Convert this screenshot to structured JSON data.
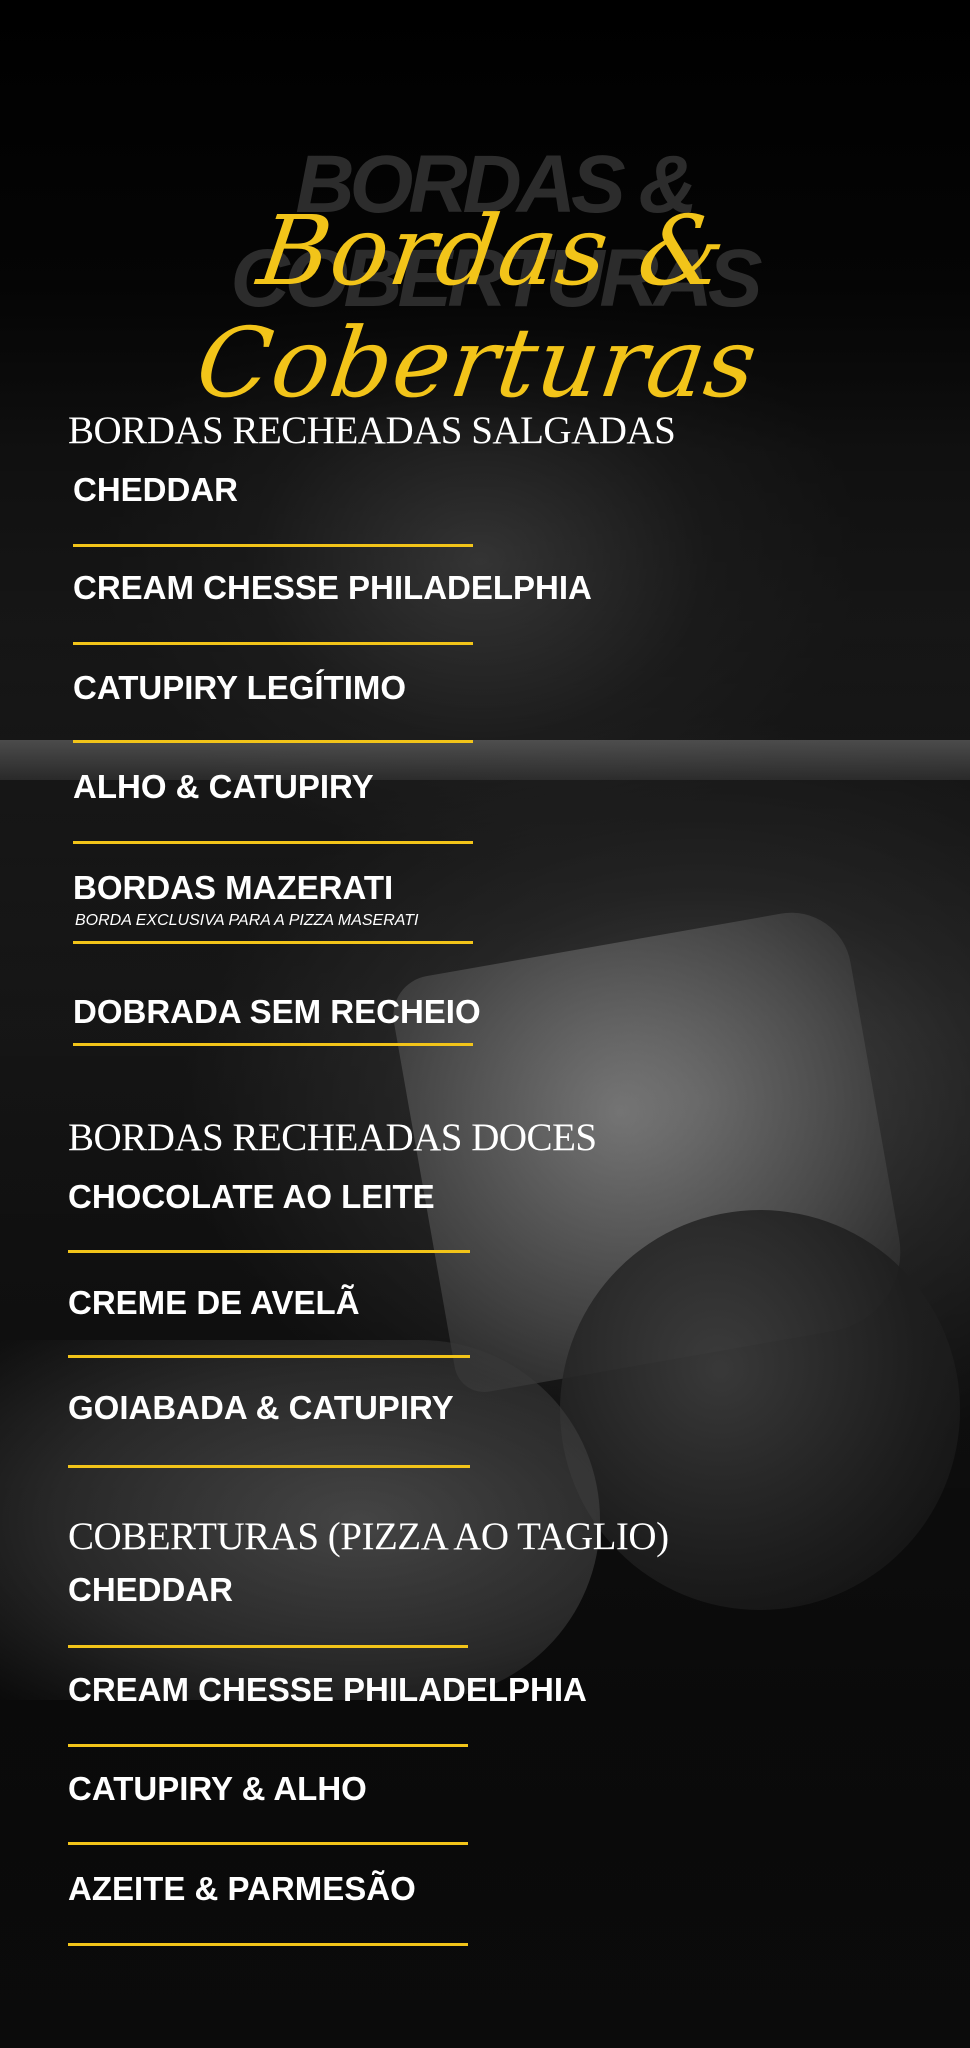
{
  "header": {
    "ghost_title": "BORDAS & COBERTURAS",
    "script_title": "Bordas & Coberturas"
  },
  "sections": [
    {
      "title": "BORDAS RECHEADAS SALGADAS",
      "items": [
        {
          "label": "CHEDDAR"
        },
        {
          "label": "CREAM CHESSE PHILADELPHIA"
        },
        {
          "label": "CATUPIRY LEGÍTIMO"
        },
        {
          "label": "ALHO & CATUPIRY"
        },
        {
          "label": "BORDAS MAZERATI",
          "note": "BORDA EXCLUSIVA PARA A PIZZA MASERATI"
        },
        {
          "label": "DOBRADA SEM RECHEIO"
        }
      ]
    },
    {
      "title": "BORDAS RECHEADAS DOCES",
      "items": [
        {
          "label": "CHOCOLATE AO LEITE"
        },
        {
          "label": "CREME DE AVELÃ"
        },
        {
          "label": "GOIABADA & CATUPIRY"
        }
      ]
    },
    {
      "title": "COBERTURAS (PIZZA AO TAGLIO)",
      "items": [
        {
          "label": "CHEDDAR"
        },
        {
          "label": "CREAM CHESSE PHILADELPHIA"
        },
        {
          "label": "CATUPIRY & ALHO"
        },
        {
          "label": "AZEITE & PARMESÃO"
        }
      ]
    }
  ],
  "colors": {
    "accent": "#f2c419",
    "text": "#ffffff",
    "background": "#000000"
  }
}
